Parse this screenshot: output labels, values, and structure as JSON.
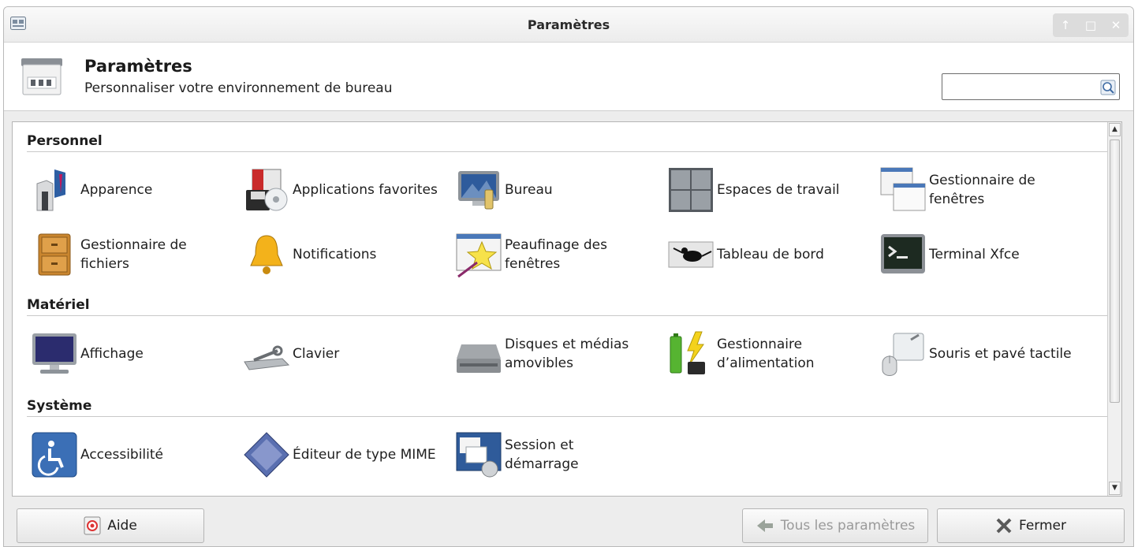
{
  "window": {
    "title": "Paramètres",
    "controls": [
      "↑",
      "□",
      "✕"
    ]
  },
  "header": {
    "title": "Paramètres",
    "subtitle": "Personnaliser votre environnement de bureau",
    "search_value": "",
    "search_placeholder": ""
  },
  "sections": [
    {
      "title": "Personnel",
      "items": [
        {
          "label": "Apparence",
          "icon": "appearance-icon"
        },
        {
          "label": "Applications favorites",
          "icon": "preferred-applications-icon"
        },
        {
          "label": "Bureau",
          "icon": "desktop-icon"
        },
        {
          "label": "Espaces de travail",
          "icon": "workspaces-icon"
        },
        {
          "label": "Gestionnaire de fenêtres",
          "icon": "window-manager-icon"
        },
        {
          "label": "Gestionnaire de fichiers",
          "icon": "file-manager-icon"
        },
        {
          "label": "Notifications",
          "icon": "bell-icon"
        },
        {
          "label": "Peaufinage des fenêtres",
          "icon": "window-tweaks-icon"
        },
        {
          "label": "Tableau de bord",
          "icon": "panel-icon"
        },
        {
          "label": "Terminal Xfce",
          "icon": "terminal-icon"
        }
      ]
    },
    {
      "title": "Matériel",
      "items": [
        {
          "label": "Affichage",
          "icon": "display-icon"
        },
        {
          "label": "Clavier",
          "icon": "keyboard-icon"
        },
        {
          "label": "Disques et médias amovibles",
          "icon": "removable-drive-icon"
        },
        {
          "label": "Gestionnaire d’alimentation",
          "icon": "power-manager-icon"
        },
        {
          "label": "Souris et pavé tactile",
          "icon": "mouse-icon"
        }
      ]
    },
    {
      "title": "Système",
      "items": [
        {
          "label": "Accessibilité",
          "icon": "accessibility-icon"
        },
        {
          "label": "Éditeur de type MIME",
          "icon": "mime-editor-icon"
        },
        {
          "label": "Session et démarrage",
          "icon": "session-startup-icon"
        }
      ]
    }
  ],
  "footer": {
    "help_label": "Aide",
    "all_settings_label": "Tous les paramètres",
    "close_label": "Fermer"
  },
  "colors": {
    "window_bg": "#ededed",
    "content_bg": "#ffffff",
    "accent_blue": "#3b6fb6"
  }
}
